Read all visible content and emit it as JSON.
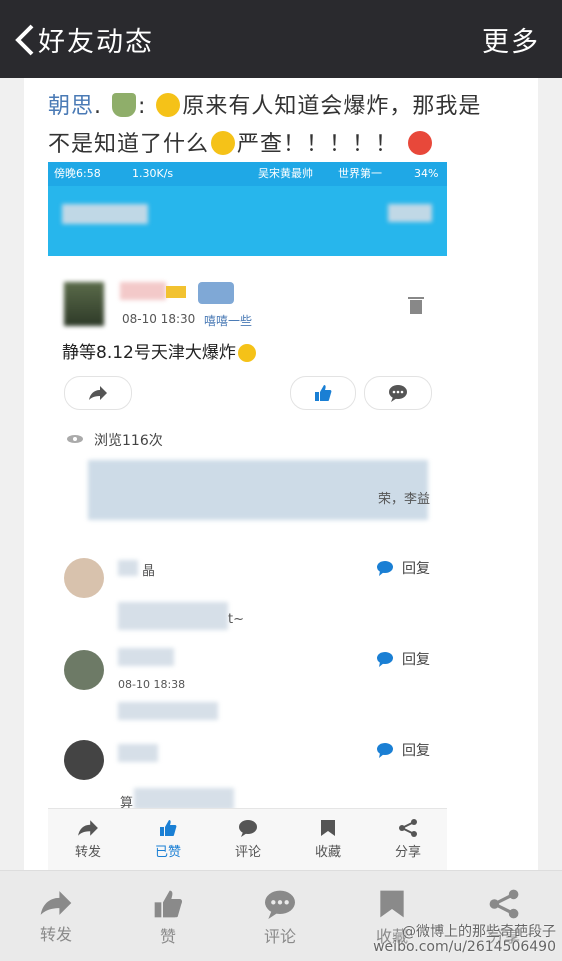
{
  "topbar": {
    "title": "好友动态",
    "more": "更多"
  },
  "post": {
    "author": "朝思",
    "text_line1": "原来有人知道会爆炸，那我是",
    "text_line2_a": "不是知道了什么",
    "text_line2_b": "严查！！！！！"
  },
  "screenshot": {
    "status": {
      "time": "傍晚6:58",
      "speed": "1.30K/s",
      "carrier": "吴宋黄最帅",
      "carrier_suffix": "世界第一",
      "battery": "34%"
    },
    "item": {
      "date": "08-10 18:30",
      "meta": "嘻嘻一些",
      "text": "静等8.12号天津大爆炸",
      "views": "浏览116次",
      "liker_suffix": "荣，李益"
    },
    "comments": [
      {
        "name": "晶",
        "reply": "回复",
        "text": "t~"
      },
      {
        "name": "",
        "reply": "回复",
        "date": "08-10 18:38"
      },
      {
        "name": "",
        "reply": "回复",
        "text": "算"
      }
    ],
    "tabbar": [
      "转发",
      "已赞",
      "评论",
      "收藏",
      "分享"
    ]
  },
  "bottombar": [
    "转发",
    "赞",
    "评论",
    "收藏",
    "分享"
  ],
  "watermark": {
    "line1": "@微博上的那些奇葩段子",
    "line2": "weibo.com/u/2614506490"
  },
  "colors": {
    "topbar": "#2a2a2e",
    "accent": "#27b6ec",
    "link": "#4a7ab5"
  }
}
